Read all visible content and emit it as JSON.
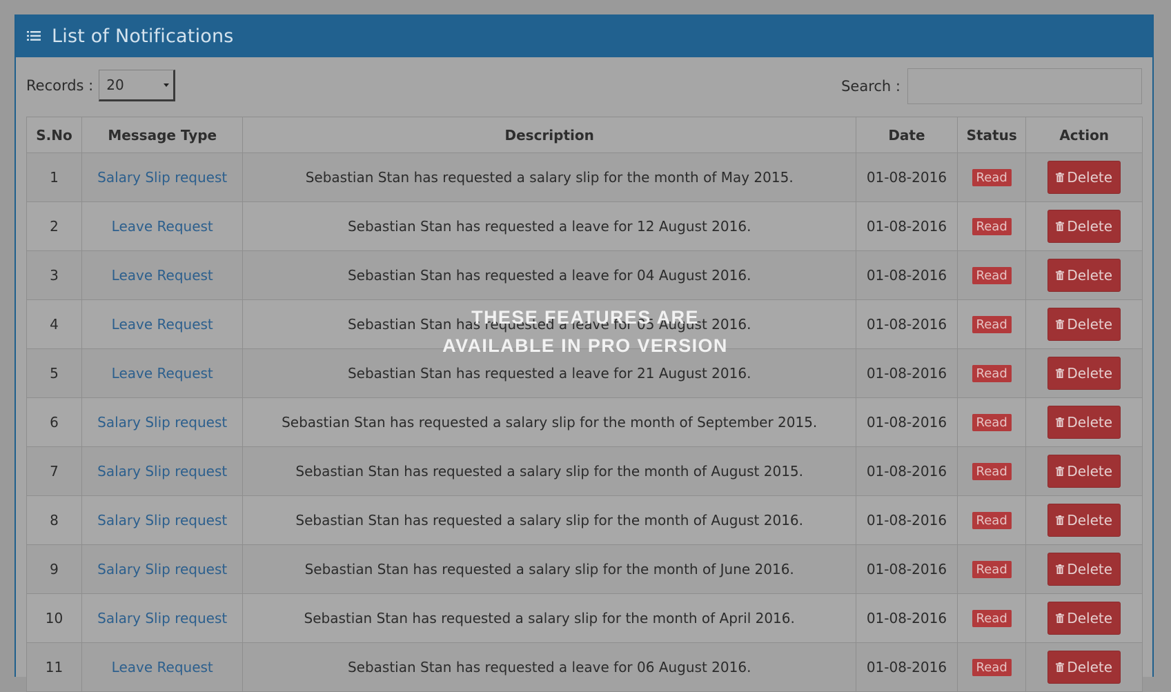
{
  "header": {
    "title": "List of Notifications",
    "icon": "list-icon"
  },
  "records": {
    "label": "Records :",
    "value": "20"
  },
  "search": {
    "label": "Search :",
    "value": ""
  },
  "table": {
    "columns": [
      "S.No",
      "Message Type",
      "Description",
      "Date",
      "Status",
      "Action"
    ],
    "delete_label": "Delete",
    "rows": [
      {
        "sno": "1",
        "type": "Salary Slip request",
        "desc": "Sebastian Stan has requested a salary slip for the month of May 2015.",
        "date": "01-08-2016",
        "status": "Read"
      },
      {
        "sno": "2",
        "type": "Leave Request",
        "desc": "Sebastian Stan has requested a leave for 12 August 2016.",
        "date": "01-08-2016",
        "status": "Read"
      },
      {
        "sno": "3",
        "type": "Leave Request",
        "desc": "Sebastian Stan has requested a leave for 04 August 2016.",
        "date": "01-08-2016",
        "status": "Read"
      },
      {
        "sno": "4",
        "type": "Leave Request",
        "desc": "Sebastian Stan has requested a leave for 05 August 2016.",
        "date": "01-08-2016",
        "status": "Read"
      },
      {
        "sno": "5",
        "type": "Leave Request",
        "desc": "Sebastian Stan has requested a leave for 21 August 2016.",
        "date": "01-08-2016",
        "status": "Read"
      },
      {
        "sno": "6",
        "type": "Salary Slip request",
        "desc": "Sebastian Stan has requested a salary slip for the month of September 2015.",
        "date": "01-08-2016",
        "status": "Read"
      },
      {
        "sno": "7",
        "type": "Salary Slip request",
        "desc": "Sebastian Stan has requested a salary slip for the month of August 2015.",
        "date": "01-08-2016",
        "status": "Read"
      },
      {
        "sno": "8",
        "type": "Salary Slip request",
        "desc": "Sebastian Stan has requested a salary slip for the month of August 2016.",
        "date": "01-08-2016",
        "status": "Read"
      },
      {
        "sno": "9",
        "type": "Salary Slip request",
        "desc": "Sebastian Stan has requested a salary slip for the month of June 2016.",
        "date": "01-08-2016",
        "status": "Read"
      },
      {
        "sno": "10",
        "type": "Salary Slip request",
        "desc": "Sebastian Stan has requested a salary slip for the month of April 2016.",
        "date": "01-08-2016",
        "status": "Read"
      },
      {
        "sno": "11",
        "type": "Leave Request",
        "desc": "Sebastian Stan has requested a leave for 06 August 2016.",
        "date": "01-08-2016",
        "status": "Read"
      }
    ]
  },
  "overlay": {
    "line1": "THESE FEATURES  ARE",
    "line2": "AVAILABLE IN PRO VERSION"
  },
  "colors": {
    "header_bg": "#21618f",
    "link": "#2c5f8d",
    "badge": "#b23a3c",
    "delete": "#9f3234"
  }
}
